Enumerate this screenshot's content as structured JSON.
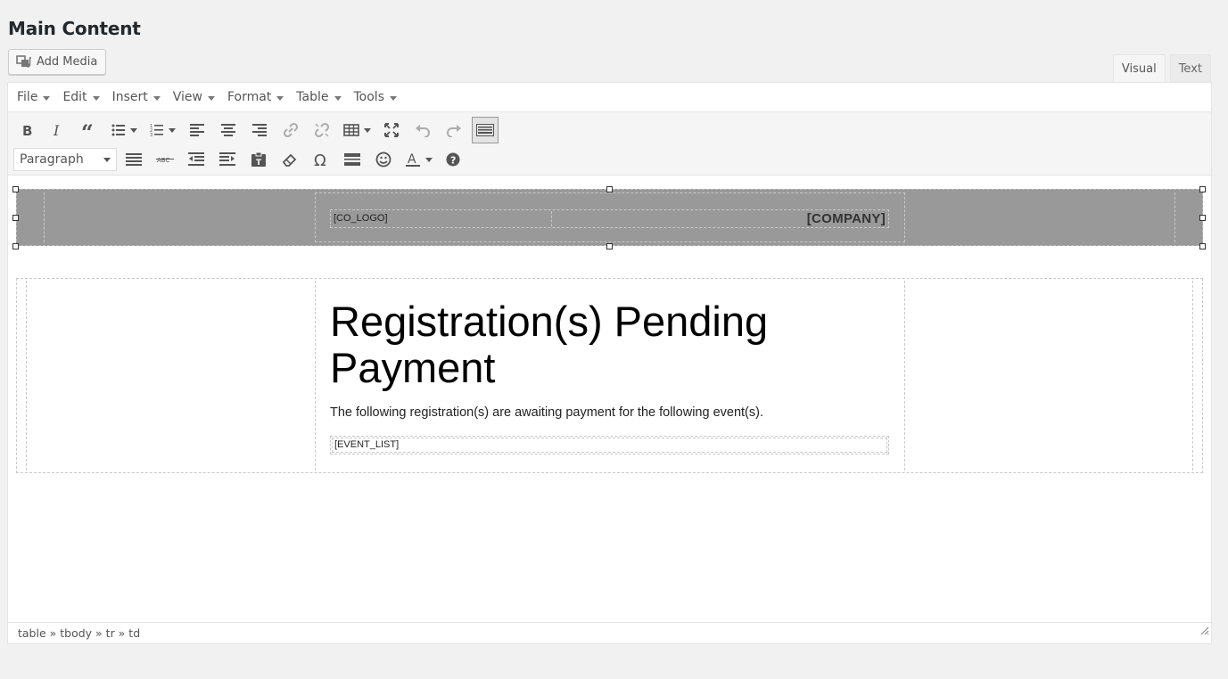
{
  "section": {
    "title": "Main Content"
  },
  "add_media": {
    "label": "Add Media",
    "icon": "add-media-icon"
  },
  "mode_tabs": [
    {
      "label": "Visual",
      "active": true
    },
    {
      "label": "Text",
      "active": false
    }
  ],
  "menubar": {
    "items": [
      {
        "label": "File"
      },
      {
        "label": "Edit"
      },
      {
        "label": "Insert"
      },
      {
        "label": "View"
      },
      {
        "label": "Format"
      },
      {
        "label": "Table"
      },
      {
        "label": "Tools"
      }
    ]
  },
  "toolbar": {
    "row1": [
      "bold-icon",
      "italic-icon",
      "blockquote-icon",
      "bullet-list-icon",
      "numbered-list-icon",
      "align-left-icon",
      "align-center-icon",
      "align-right-icon",
      "link-icon",
      "unlink-icon",
      "table-icon",
      "fullscreen-icon",
      "undo-icon",
      "redo-icon",
      "toolbar-toggle-icon"
    ],
    "row2": [
      "justify-icon",
      "strikethrough-icon",
      "outdent-icon",
      "indent-icon",
      "paste-text-icon",
      "clear-format-icon",
      "special-char-icon",
      "horizontal-rule-icon",
      "emoticons-icon",
      "text-color-icon",
      "help-icon"
    ],
    "format_select": "Paragraph"
  },
  "content": {
    "logo_shortcode": "[CO_LOGO]",
    "company_shortcode": "[COMPANY]",
    "headline": "Registration(s) Pending Payment",
    "lead": "The following registration(s) are awaiting payment for the following event(s).",
    "event_list_shortcode": "[EVENT_LIST]"
  },
  "statusbar": {
    "path": "table » tbody » tr » td"
  },
  "colors": {
    "band": "#999999",
    "page_bg": "#f1f1f1",
    "editor_bg": "#ffffff"
  }
}
